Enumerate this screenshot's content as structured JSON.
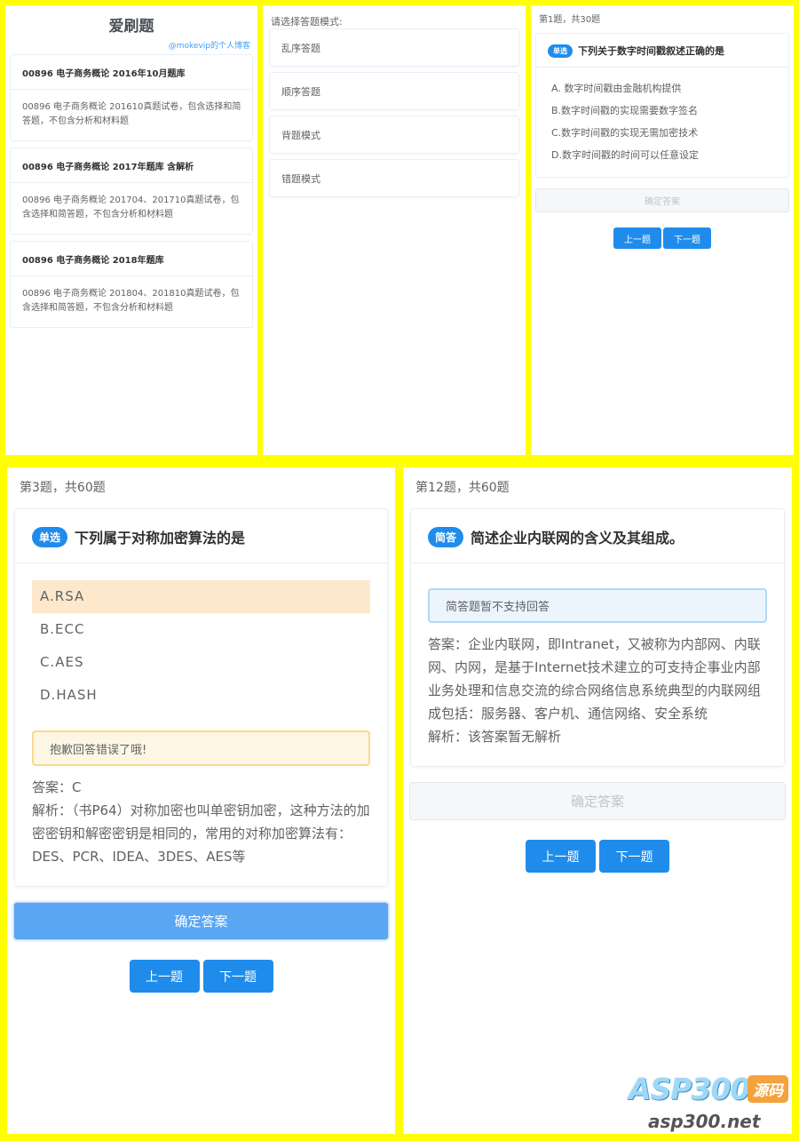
{
  "bank_list": {
    "title": "爱刷题",
    "subtitle": "@mokevip的个人博客",
    "banks": [
      {
        "title": "00896 电子商务概论 2016年10月题库",
        "desc": "00896 电子商务概论 201610真题试卷，包含选择和简答题，不包含分析和材料题"
      },
      {
        "title": "00896 电子商务概论 2017年题库 含解析",
        "desc": "00896 电子商务概论 201704、201710真题试卷，包含选择和简答题，不包含分析和材料题"
      },
      {
        "title": "00896 电子商务概论 2018年题库",
        "desc": "00896 电子商务概论 201804、201810真题试卷，包含选择和简答题，不包含分析和材料题"
      }
    ]
  },
  "mode_select": {
    "prompt": "请选择答题模式:",
    "modes": [
      "乱序答题",
      "顺序答题",
      "背题模式",
      "错题模式"
    ]
  },
  "question_small": {
    "counter": "第1题，共30题",
    "type_tag": "单选",
    "question": "下列关于数字时间戳叙述正确的是",
    "options": [
      "A. 数字时间戳由金融机构提供",
      "B.数字时间戳的实现需要数字签名",
      "C.数字时间戳的实现无需加密技术",
      "D.数字时间戳的时间可以任意设定"
    ],
    "confirm": "确定答案",
    "prev": "上一题",
    "next": "下一题"
  },
  "question_wrong": {
    "counter": "第3题，共60题",
    "type_tag": "单选",
    "question": "下列属于对称加密算法的是",
    "options": [
      "A.RSA",
      "B.ECC",
      "C.AES",
      "D.HASH"
    ],
    "selected_index": 0,
    "feedback": "抱歉回答错误了哦!",
    "answer": "答案：C",
    "analysis": "解析：（书P64）对称加密也叫单密钥加密，这种方法的加密密钥和解密密钥是相同的，常用的对称加密算法有：DES、PCR、IDEA、3DES、AES等",
    "confirm": "确定答案",
    "prev": "上一题",
    "next": "下一题"
  },
  "question_essay": {
    "counter": "第12题，共60题",
    "type_tag": "简答",
    "question": "简述企业内联网的含义及其组成。",
    "notice": "简答题暂不支持回答",
    "answer": "答案：企业内联网，即Intranet，又被称为内部网、内联网、内网，是基于Internet技术建立的可支持企事业内部业务处理和信息交流的综合网络信息系统典型的内联网组成包括：服务器、客户机、通信网络、安全系统",
    "analysis": "解析：该答案暂无解析",
    "confirm": "确定答案",
    "prev": "上一题",
    "next": "下一题"
  },
  "watermark": {
    "brand": "ASP300",
    "badge": "源码",
    "url": "asp300.net"
  },
  "colors": {
    "frame": "#ffff00",
    "primary": "#1f8ceb",
    "selected_option": "#fde8cc",
    "warning_border": "#fbd98a"
  }
}
